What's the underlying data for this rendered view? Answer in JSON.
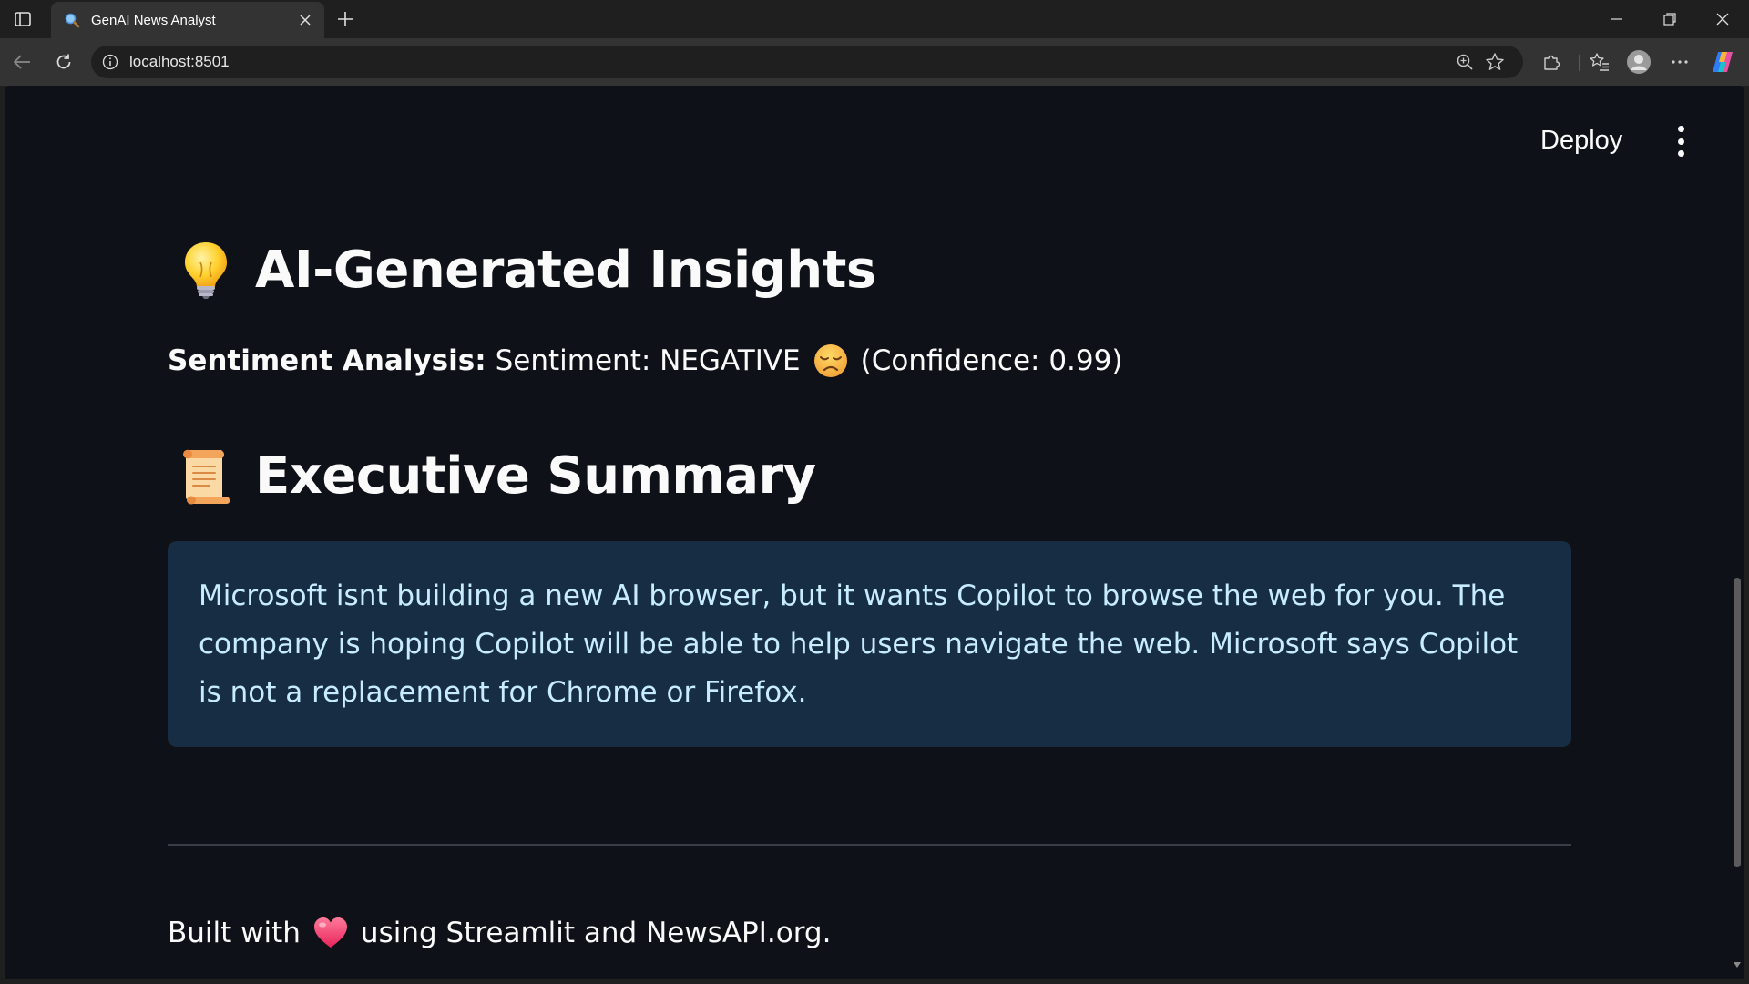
{
  "browser": {
    "tab_title": "GenAI News Analyst",
    "url": "localhost:8501"
  },
  "app": {
    "deploy_label": "Deploy"
  },
  "insights": {
    "heading": "AI-Generated Insights",
    "sentiment_label": "Sentiment Analysis:",
    "sentiment_value": "Sentiment: NEGATIVE",
    "confidence_text": "(Confidence: 0.99)",
    "sentiment_emoji": "disappointed-face-icon"
  },
  "summary": {
    "heading": "Executive Summary",
    "text": "Microsoft isnt building a new AI browser, but it wants Copilot to browse the web for you. The company is hoping Copilot will be able to help users navigate the web. Microsoft says Copilot is not a replacement for Chrome or Firefox."
  },
  "footer": {
    "text_before": "Built with",
    "text_after": "using Streamlit and NewsAPI.org."
  },
  "colors": {
    "page_bg": "#0e1117",
    "info_box_bg": "#172d43",
    "info_box_text": "#c7ebff",
    "text": "#fafafa"
  }
}
